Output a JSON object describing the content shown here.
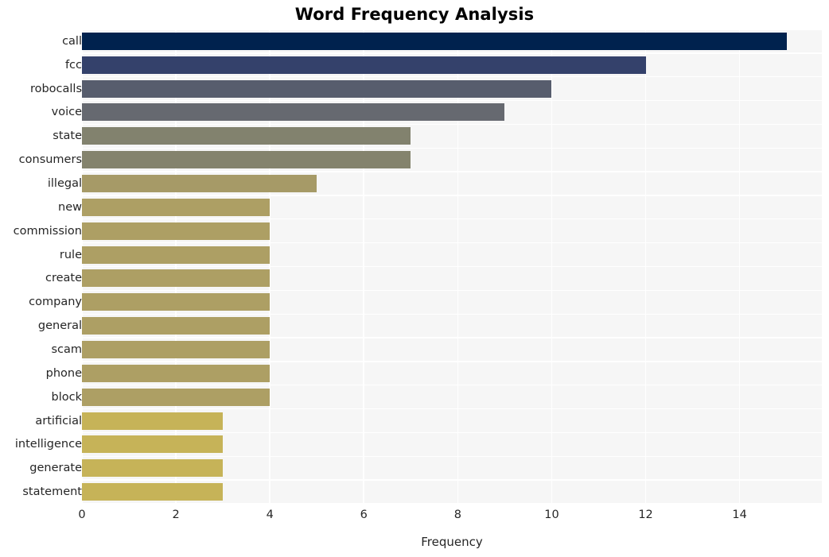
{
  "chart_data": {
    "type": "bar",
    "orientation": "horizontal",
    "title": "Word Frequency Analysis",
    "xlabel": "Frequency",
    "ylabel": "",
    "categories": [
      "call",
      "fcc",
      "robocalls",
      "voice",
      "state",
      "consumers",
      "illegal",
      "new",
      "commission",
      "rule",
      "create",
      "company",
      "general",
      "scam",
      "phone",
      "block",
      "artificial",
      "intelligence",
      "generate",
      "statement"
    ],
    "values": [
      15,
      12,
      10,
      9,
      7,
      7,
      5,
      4,
      4,
      4,
      4,
      4,
      4,
      4,
      4,
      4,
      3,
      3,
      3,
      3
    ],
    "bar_colors": [
      "#00224e",
      "#34416b",
      "#575d6d",
      "#666970",
      "#82826e",
      "#84836d",
      "#a69a67",
      "#ad9f64",
      "#ad9f64",
      "#ad9f64",
      "#ad9f64",
      "#ad9f64",
      "#ad9f64",
      "#ad9f64",
      "#ad9f64",
      "#ad9f64",
      "#c6b358",
      "#c6b358",
      "#c6b358",
      "#c6b358"
    ],
    "xticks": [
      0,
      2,
      4,
      6,
      8,
      10,
      12,
      14
    ],
    "xtick_labels": [
      "0",
      "2",
      "4",
      "6",
      "8",
      "10",
      "12",
      "14"
    ],
    "xlim": [
      0,
      15.75
    ],
    "grid": true,
    "grid_color": "#ffffff",
    "plot_background": "#f6f6f6",
    "figure_background": "#ffffff",
    "colormap": "cividis",
    "legend": null
  }
}
